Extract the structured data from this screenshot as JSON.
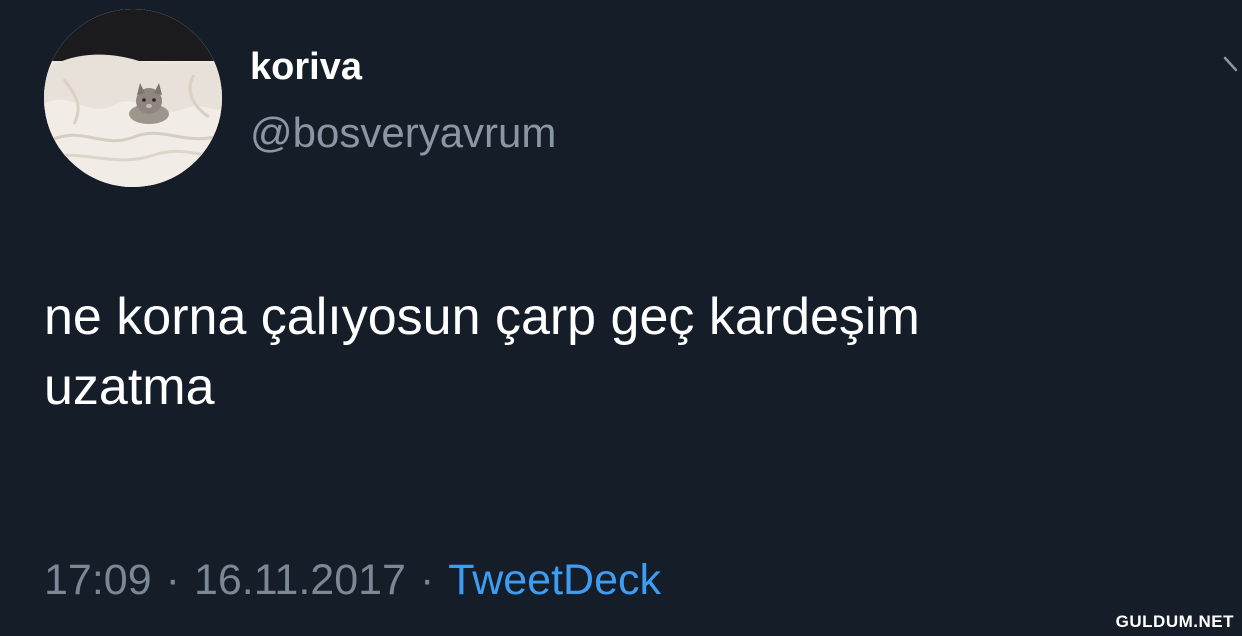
{
  "tweet": {
    "display_name": "koriva",
    "handle": "@bosveryavrum",
    "text_lines": [
      "ne korna çalıyosun çarp geç kardeşim",
      "uzatma"
    ],
    "time": "17:09",
    "date": "16.11.2017",
    "separator": "·",
    "source": "TweetDeck"
  },
  "icons": {
    "menu": "chevron-down-icon",
    "avatar": "cat-photo"
  },
  "colors": {
    "background": "#151d29",
    "text": "#ffffff",
    "secondary_text": "#8a96a3",
    "link": "#3d9df3"
  },
  "watermark": "GULDUM.NET"
}
